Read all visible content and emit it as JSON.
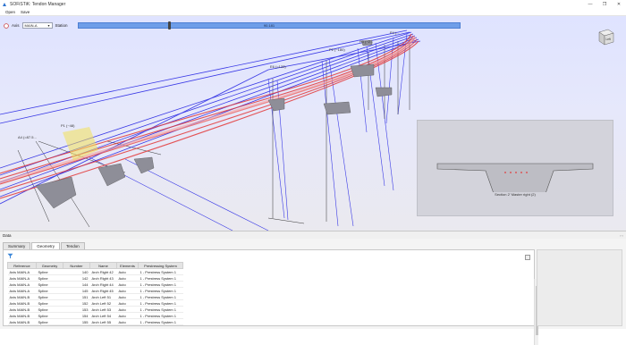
{
  "window": {
    "title": "SOFiSTiK: Tendon Manager",
    "controls": [
      "—",
      "❐",
      "✕"
    ]
  },
  "menu": {
    "items": [
      "Open",
      "Save"
    ]
  },
  "toolbar": {
    "axis_label": "Axis",
    "axis_value": "MAIN-A",
    "station_label": "Station",
    "station_value": "90.181"
  },
  "nav_cube_label": "Left",
  "viewport_labels": {
    "p1": "P1 (~48)",
    "a4": "A4 (=87.5...",
    "e6": "E6 (=133)",
    "p2": "P2 (~180)",
    "p3": "P3 (~2...",
    "p4": "P4 (..."
  },
  "section_view": {
    "caption": "Section 2' Master right (2)"
  },
  "data_panel": {
    "title": "Data",
    "panel_buttons": "▫ ▫",
    "tabs": [
      "Summary",
      "Geometry",
      "Tendon"
    ],
    "active_tab": "Geometry",
    "columns": [
      "Reference",
      "Geometry",
      "Number",
      "Name",
      "Elements",
      "Prestressing System"
    ],
    "rows": [
      [
        "Axis MAIN-A",
        "Spline",
        "140",
        "Arch Right 42",
        "Auto",
        "1 - Prestress System 1"
      ],
      [
        "Axis MAIN-A",
        "Spline",
        "142",
        "Arch Right 43",
        "Auto",
        "1 - Prestress System 1"
      ],
      [
        "Axis MAIN-A",
        "Spline",
        "144",
        "Arch Right 44",
        "Auto",
        "1 - Prestress System 1"
      ],
      [
        "Axis MAIN-A",
        "Spline",
        "145",
        "Arch Right 45",
        "Auto",
        "1 - Prestress System 1"
      ],
      [
        "Axis MAIN-B",
        "Spline",
        "151",
        "Arch Left 51",
        "Auto",
        "1 - Prestress System 1"
      ],
      [
        "Axis MAIN-B",
        "Spline",
        "152",
        "Arch Left 52",
        "Auto",
        "1 - Prestress System 1"
      ],
      [
        "Axis MAIN-B",
        "Spline",
        "153",
        "Arch Left 53",
        "Auto",
        "1 - Prestress System 1"
      ],
      [
        "Axis MAIN-B",
        "Spline",
        "154",
        "Arch Left 54",
        "Auto",
        "1 - Prestress System 1"
      ],
      [
        "Axis MAIN-B",
        "Spline",
        "155",
        "Arch Left 55",
        "Auto",
        "1 - Prestress System 1"
      ]
    ]
  },
  "colors": {
    "accent": "#4d7fd3",
    "tendon_red": "#e33a3a",
    "tendon_blue": "#3a3ae6",
    "highlight": "#f3e05a"
  }
}
